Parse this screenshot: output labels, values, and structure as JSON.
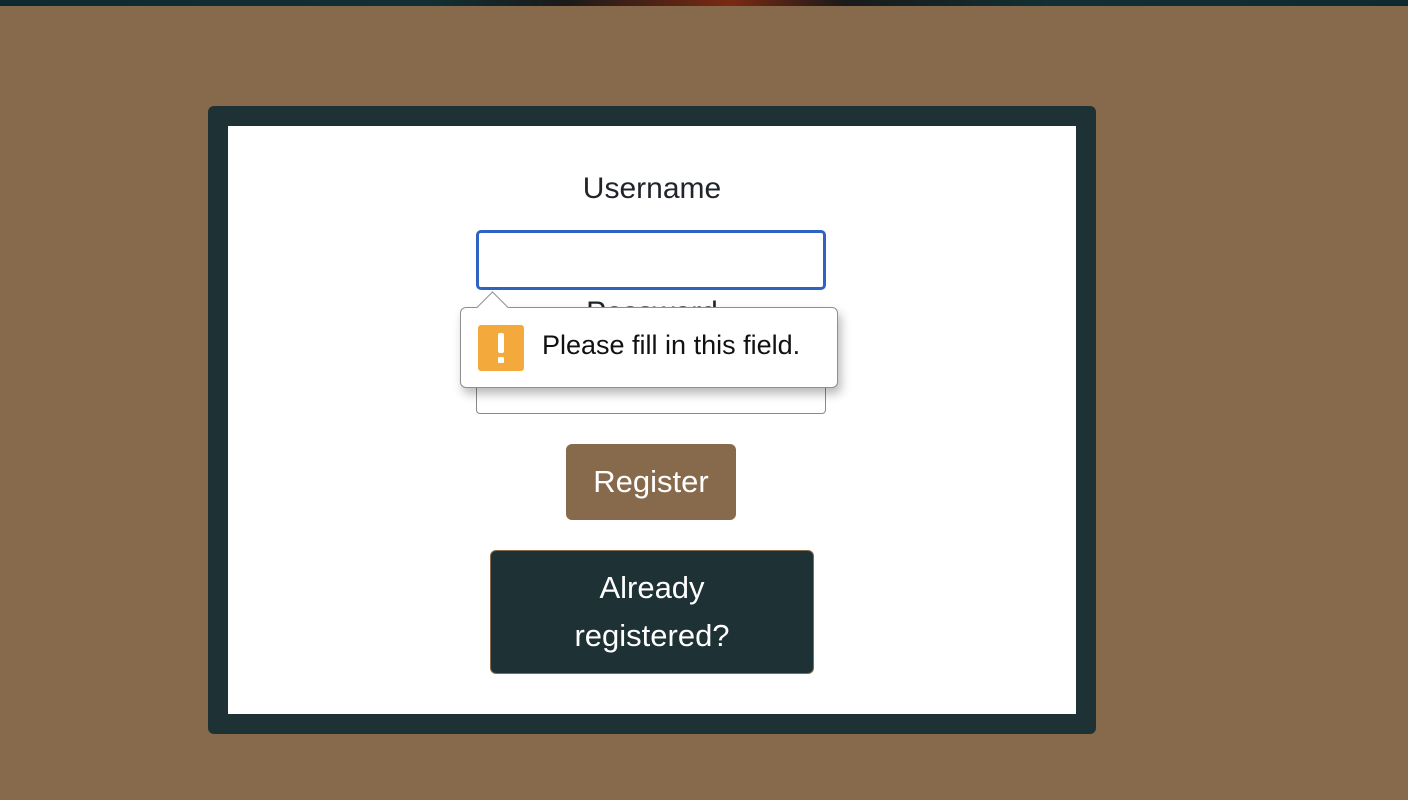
{
  "form": {
    "username_label": "Username",
    "username_value": "",
    "password_label": "Password",
    "password_value": "",
    "register_label": "Register",
    "login_label": "Already registered?"
  },
  "validation_tooltip": {
    "message": "Please fill in this field.",
    "icon": "warning-icon"
  },
  "colors": {
    "page_background": "#876a4c",
    "card_frame": "#1e3134",
    "register_button": "#876a4c",
    "login_button": "#1e3134",
    "focus_ring": "#2f63c2",
    "warning": "#f3a93b"
  }
}
